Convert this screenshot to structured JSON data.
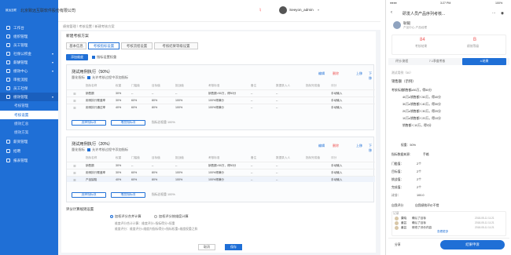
{
  "app": {
    "company": "北京致远互联软件股份有限公司",
    "user": "Seeyon_admin",
    "logo": "致远互联"
  },
  "sidebar": {
    "items": [
      "工作台",
      "组织管理",
      "员工管理",
      "社保公积金",
      "薪酬管理",
      "绩效中心",
      "审批流程",
      "员工社保",
      "绩效管理",
      "考核管理",
      "考核设置",
      "绩效汇总",
      "绩效方案",
      "薪资管理",
      "招聘",
      "报表管理"
    ]
  },
  "breadcrumb": "绩效管理 / 考核设置 / 新建考核方案",
  "card": {
    "title": "新建考核方案",
    "tabs": [
      "基本信息",
      "考核指标设置",
      "考核流程设置",
      "考核结果等级设置"
    ],
    "add_button": "添加维度",
    "weight_check": "指标设置权重"
  },
  "sections": [
    {
      "title": "测试用例执行（50%）",
      "sub": "量化指标",
      "sub2": "允许考核过程中添加指标",
      "actions": [
        "编辑",
        "删除",
        "上移",
        "下移"
      ],
      "headers": [
        "指标名称",
        "权重",
        "门槛值",
        "目标值",
        "挑战值",
        "考核标准",
        "备注",
        "数据录入人",
        "指标完成值",
        "评分"
      ],
      "rows": [
        [
          "销售额",
          "30%",
          "--",
          "--",
          "--",
          "销售额>50万，得50分",
          "--",
          "--",
          "手动输入"
        ],
        [
          "用例执行覆盖率",
          "30%",
          "60%",
          "80%",
          "100%",
          "100%得满分",
          "--",
          "--",
          "手动输入"
        ],
        [
          "用例执行通过率",
          "40%",
          "60%",
          "80%",
          "100%",
          "100%得满分",
          "--",
          "--",
          "手动输入"
        ]
      ],
      "btn_add": "选择指标项",
      "btn_custom": "增加指标项",
      "sum": "指标总权重 100%"
    },
    {
      "title": "测试用例执行（20%）",
      "sub": "量化指标",
      "sub2": "允许考核过程中添加指标",
      "actions": [
        "编辑",
        "删除",
        "上移",
        "下移"
      ],
      "headers": [
        "指标名称",
        "权重",
        "门槛值",
        "目标值",
        "挑战值",
        "考核标准",
        "备注",
        "数据录入人",
        "指标完成值",
        "评分"
      ],
      "rows": [
        [
          "销售额",
          "30%",
          "--",
          "--",
          "--",
          "销售额>50万，得50分",
          "--",
          "--",
          "手动输入"
        ],
        [
          "用例执行覆盖率",
          "30%",
          "60%",
          "80%",
          "100%",
          "100%得满分",
          "--",
          "--",
          "手动输入"
        ],
        [
          "产品缺陷",
          "40%",
          "60%",
          "80%",
          "100%",
          "100%得满分",
          "--",
          "--",
          "手动输入"
        ]
      ],
      "btn_add": "选择指标项",
      "btn_custom": "增加指标项",
      "sum": "指标总权重 100%"
    }
  ],
  "rule": {
    "label": "评分计算规则设置",
    "opt1": "加权评分合并计算",
    "opt2": "加权评分按维度计算",
    "desc1": "维度评分合计计算：维度评分=指标得分×权重",
    "desc2": "维度评分：维度评分=维度内指标得分×指标权重×维度权重之和"
  },
  "footer": {
    "cancel": "取消",
    "save": "保存"
  },
  "phone": {
    "time": "3:27 PM",
    "battery": "100%",
    "title": "研发人员产品序列考核...",
    "name": "耿毅",
    "dept": "产品中心-产品经理",
    "score_label": "考核结果",
    "score": "84",
    "grade_label": "绩效等级",
    "grade": "B",
    "tabs": [
      "评分/流程",
      "7.1季度考核",
      "4.结果"
    ],
    "dim": "测试用例（50）",
    "metric": "销售额（示例）",
    "std_label": "考核标准：",
    "std_lines": [
      "销售额≥50万，得50分",
      "40万≤销售额＜50万，得40分",
      "30万≤销售额＜40万，得30分",
      "20万≤销售额＜30万，得20分",
      "10万≤销售额＜20万，得10分",
      "销售额＜10万，得0分"
    ],
    "weight": "权重：50%",
    "data_label": "指标数据来源：",
    "data_val": "手输",
    "fields": [
      [
        "门槛值：",
        "2个"
      ],
      [
        "目标值：",
        "2个"
      ],
      [
        "挑战值：",
        "2个"
      ],
      [
        "完成值：",
        "2个"
      ],
      [
        "计分：",
        "100.0"
      ]
    ],
    "self_eval": "自我评分",
    "self_val": "自我绩效评价不错",
    "records_title": "记录",
    "records": [
      [
        "康晓",
        "确认了目标",
        "2018-05-11 11:21"
      ],
      [
        "姜芸",
        "确认了目标",
        "2018-05-11 11:21"
      ],
      [
        "姜芸",
        "修改了评价内容",
        "2018-05-11 11:21"
      ]
    ],
    "more": "查看更多",
    "btn_share": "分享",
    "btn_submit": "结果申诉"
  }
}
